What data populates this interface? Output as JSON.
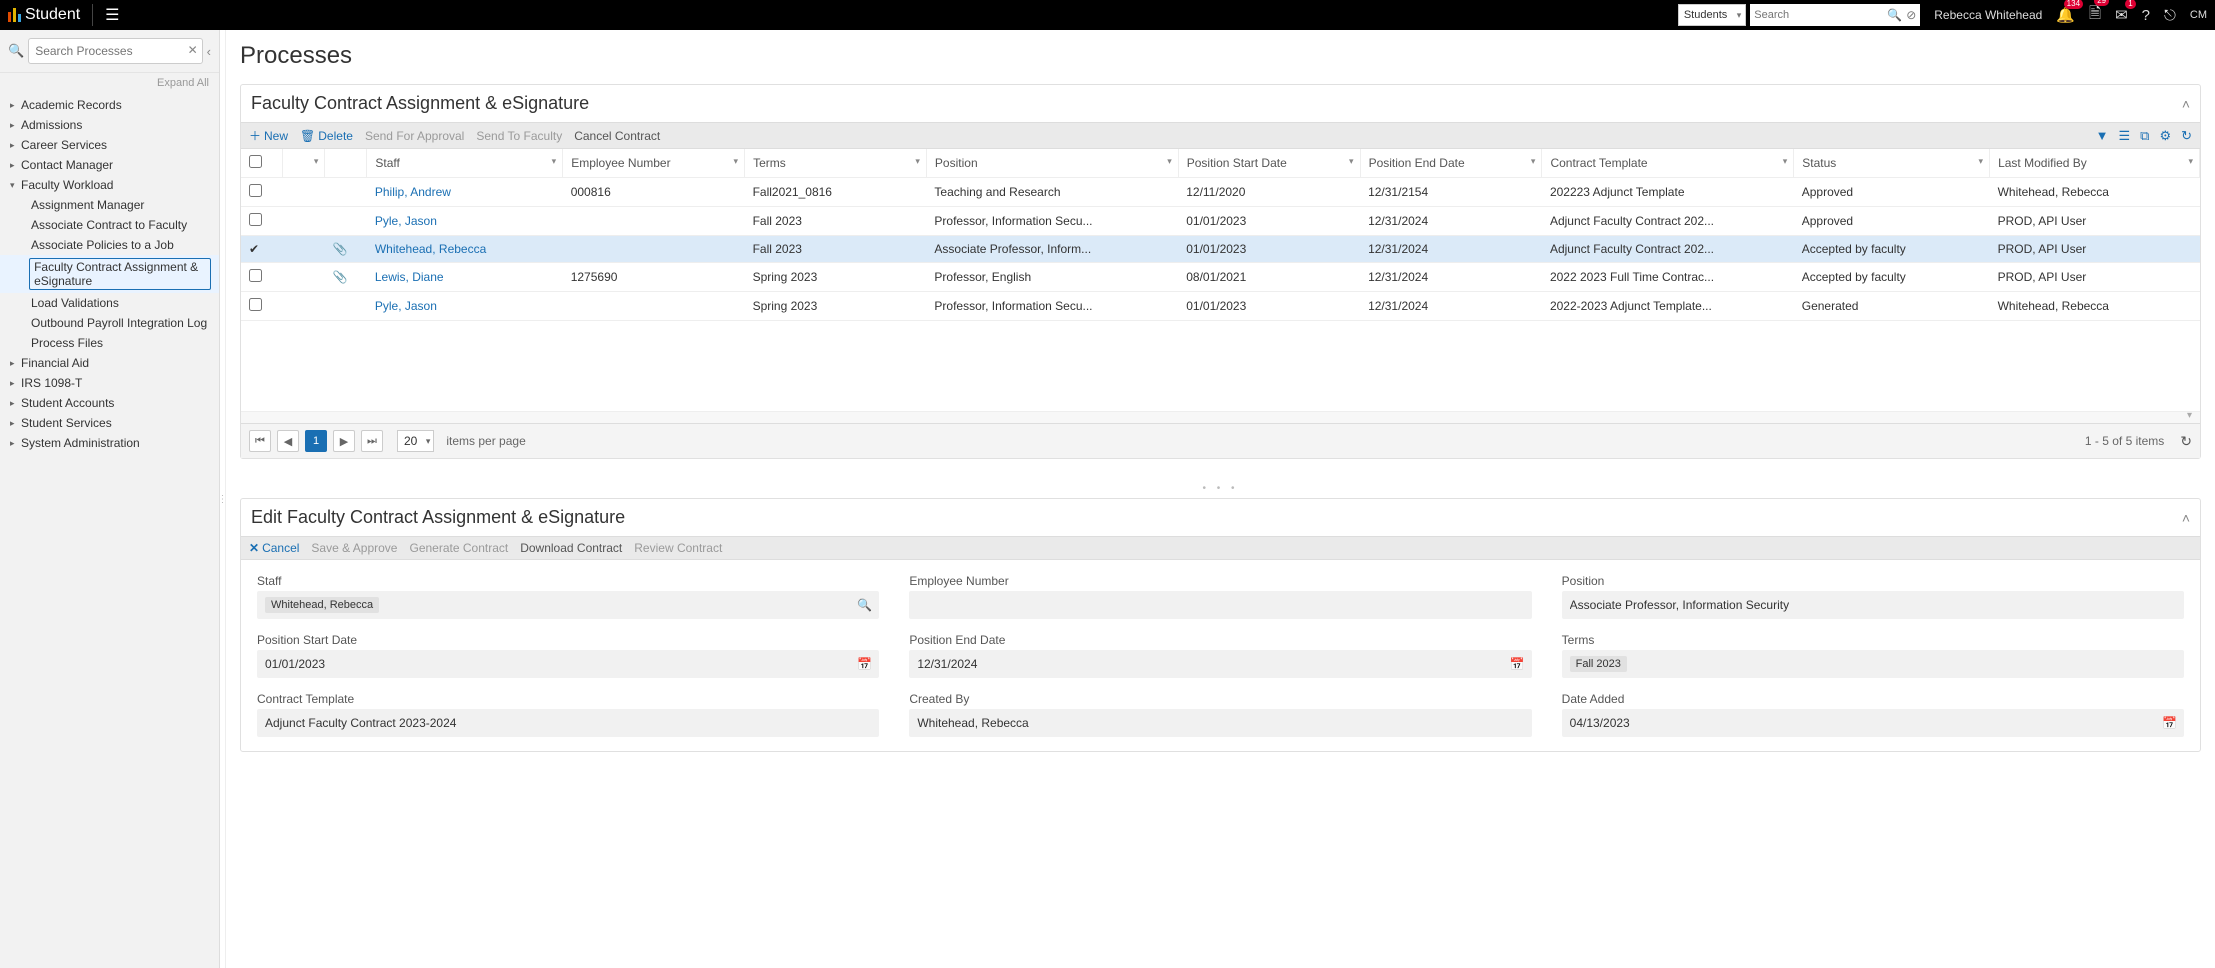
{
  "brand": "Student",
  "scope_selector": "Students",
  "search_placeholder": "Search",
  "user_name": "Rebecca Whitehead",
  "top_badges": {
    "bell": "134",
    "doc": "29",
    "mail": "1"
  },
  "avatar_initials": "CM",
  "side_search_placeholder": "Search Processes",
  "expand_all": "Expand All",
  "nav": {
    "roots": [
      {
        "label": "Academic Records",
        "expanded": false
      },
      {
        "label": "Admissions",
        "expanded": false
      },
      {
        "label": "Career Services",
        "expanded": false
      },
      {
        "label": "Contact Manager",
        "expanded": false
      },
      {
        "label": "Faculty Workload",
        "expanded": true,
        "children": [
          "Assignment Manager",
          "Associate Contract to Faculty",
          "Associate Policies to a Job",
          "Faculty Contract Assignment & eSignature",
          "Load Validations",
          "Outbound Payroll Integration Log",
          "Process Files"
        ],
        "selected_child_index": 3
      },
      {
        "label": "Financial Aid",
        "expanded": false
      },
      {
        "label": "IRS 1098-T",
        "expanded": false
      },
      {
        "label": "Student Accounts",
        "expanded": false
      },
      {
        "label": "Student Services",
        "expanded": false
      },
      {
        "label": "System Administration",
        "expanded": false
      }
    ]
  },
  "page_title": "Processes",
  "panel1": {
    "title": "Faculty Contract Assignment & eSignature",
    "toolbar": {
      "new": "New",
      "delete": "Delete",
      "send_approval": "Send For Approval",
      "send_faculty": "Send To Faculty",
      "cancel_contract": "Cancel Contract"
    },
    "columns": [
      "Staff",
      "Employee Number",
      "Terms",
      "Position",
      "Position Start Date",
      "Position End Date",
      "Contract Template",
      "Status",
      "Last Modified By"
    ],
    "rows": [
      {
        "checked": false,
        "attach": false,
        "staff": "Philip, Andrew",
        "emp": "000816",
        "terms": "Fall2021_0816",
        "position": "Teaching and Research",
        "start": "12/11/2020",
        "end": "12/31/2154",
        "template": "202223 Adjunct Template",
        "status": "Approved",
        "modby": "Whitehead, Rebecca"
      },
      {
        "checked": false,
        "attach": false,
        "staff": "Pyle, Jason",
        "emp": "",
        "terms": "Fall 2023",
        "position": "Professor, Information Secu...",
        "start": "01/01/2023",
        "end": "12/31/2024",
        "template": "Adjunct Faculty Contract 202...",
        "status": "Approved",
        "modby": "PROD, API User"
      },
      {
        "checked": true,
        "attach": true,
        "staff": "Whitehead, Rebecca",
        "emp": "",
        "terms": "Fall 2023",
        "position": "Associate Professor, Inform...",
        "start": "01/01/2023",
        "end": "12/31/2024",
        "template": "Adjunct Faculty Contract 202...",
        "status": "Accepted by faculty",
        "modby": "PROD, API User"
      },
      {
        "checked": false,
        "attach": true,
        "staff": "Lewis, Diane",
        "emp": "1275690",
        "terms": "Spring 2023",
        "position": "Professor, English",
        "start": "08/01/2021",
        "end": "12/31/2024",
        "template": "2022 2023 Full Time Contrac...",
        "status": "Accepted by faculty",
        "modby": "PROD, API User"
      },
      {
        "checked": false,
        "attach": false,
        "staff": "Pyle, Jason",
        "emp": "",
        "terms": "Spring 2023",
        "position": "Professor, Information Secu...",
        "start": "01/01/2023",
        "end": "12/31/2024",
        "template": "2022-2023 Adjunct Template...",
        "status": "Generated",
        "modby": "Whitehead, Rebecca"
      }
    ],
    "pager": {
      "page": "1",
      "size": "20",
      "label": "items per page",
      "range": "1 - 5 of 5 items"
    }
  },
  "panel2": {
    "title": "Edit Faculty Contract Assignment & eSignature",
    "toolbar": {
      "cancel": "Cancel",
      "save_approve": "Save & Approve",
      "generate": "Generate Contract",
      "download": "Download Contract",
      "review": "Review Contract"
    },
    "fields": {
      "staff": {
        "label": "Staff",
        "value": "Whitehead, Rebecca"
      },
      "emp": {
        "label": "Employee Number",
        "value": ""
      },
      "position": {
        "label": "Position",
        "value": "Associate Professor, Information Security"
      },
      "start": {
        "label": "Position Start Date",
        "value": "01/01/2023"
      },
      "end": {
        "label": "Position End Date",
        "value": "12/31/2024"
      },
      "terms": {
        "label": "Terms",
        "chip": "Fall 2023"
      },
      "template": {
        "label": "Contract Template",
        "value": "Adjunct Faculty Contract 2023-2024"
      },
      "createdby": {
        "label": "Created By",
        "value": "Whitehead, Rebecca"
      },
      "dateadded": {
        "label": "Date Added",
        "value": "04/13/2023"
      }
    }
  }
}
